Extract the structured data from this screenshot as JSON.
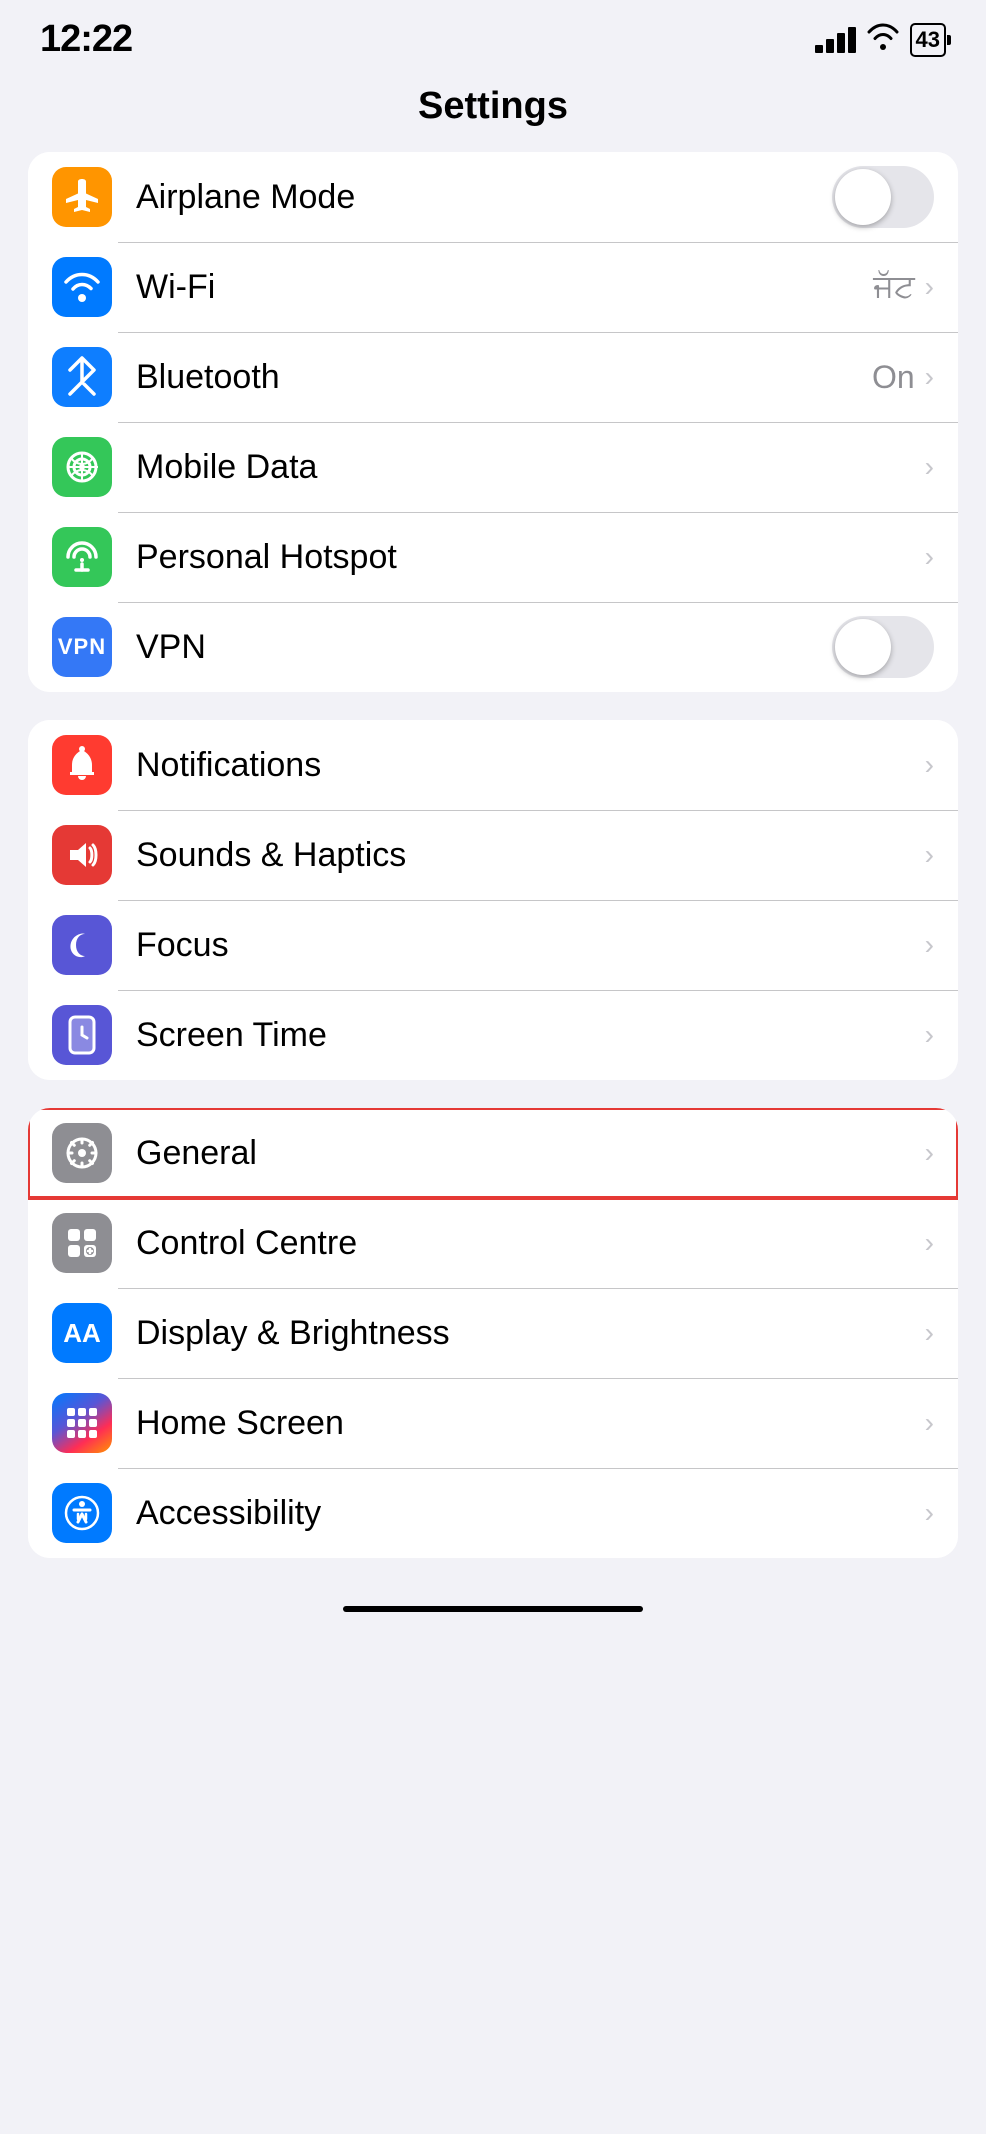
{
  "statusBar": {
    "time": "12:22",
    "battery": "43"
  },
  "pageTitle": "Settings",
  "groups": [
    {
      "id": "connectivity",
      "rows": [
        {
          "id": "airplane-mode",
          "label": "Airplane Mode",
          "icon": "airplane",
          "iconBg": "bg-orange",
          "control": "toggle",
          "toggleOn": false
        },
        {
          "id": "wifi",
          "label": "Wi-Fi",
          "icon": "wifi",
          "iconBg": "bg-blue",
          "control": "chevron",
          "value": "ਜੱਟ"
        },
        {
          "id": "bluetooth",
          "label": "Bluetooth",
          "icon": "bluetooth",
          "iconBg": "bg-blue-dark",
          "control": "chevron",
          "value": "On"
        },
        {
          "id": "mobile-data",
          "label": "Mobile Data",
          "icon": "signal",
          "iconBg": "bg-green",
          "control": "chevron",
          "value": ""
        },
        {
          "id": "personal-hotspot",
          "label": "Personal Hotspot",
          "icon": "hotspot",
          "iconBg": "bg-green",
          "control": "chevron",
          "value": ""
        },
        {
          "id": "vpn",
          "label": "VPN",
          "icon": "vpn",
          "iconBg": "bg-blue-vpn",
          "control": "toggle",
          "toggleOn": false
        }
      ]
    },
    {
      "id": "notifications-group",
      "rows": [
        {
          "id": "notifications",
          "label": "Notifications",
          "icon": "bell",
          "iconBg": "bg-red",
          "control": "chevron",
          "value": ""
        },
        {
          "id": "sounds-haptics",
          "label": "Sounds & Haptics",
          "icon": "speaker",
          "iconBg": "bg-red-sound",
          "control": "chevron",
          "value": ""
        },
        {
          "id": "focus",
          "label": "Focus",
          "icon": "moon",
          "iconBg": "bg-purple",
          "control": "chevron",
          "value": ""
        },
        {
          "id": "screen-time",
          "label": "Screen Time",
          "icon": "hourglass",
          "iconBg": "bg-purple-screen",
          "control": "chevron",
          "value": ""
        }
      ]
    },
    {
      "id": "general-group",
      "rows": [
        {
          "id": "general",
          "label": "General",
          "icon": "gear",
          "iconBg": "bg-gray",
          "control": "chevron",
          "value": "",
          "highlighted": true
        },
        {
          "id": "control-centre",
          "label": "Control Centre",
          "icon": "toggles",
          "iconBg": "bg-gray-cc",
          "control": "chevron",
          "value": ""
        },
        {
          "id": "display-brightness",
          "label": "Display & Brightness",
          "icon": "AA",
          "iconBg": "bg-blue-aa",
          "control": "chevron",
          "value": ""
        },
        {
          "id": "home-screen",
          "label": "Home Screen",
          "icon": "grid",
          "iconBg": "bg-multicolor",
          "control": "chevron",
          "value": ""
        },
        {
          "id": "accessibility",
          "label": "Accessibility",
          "icon": "person-circle",
          "iconBg": "bg-blue-access",
          "control": "chevron",
          "value": ""
        }
      ]
    }
  ],
  "icons": {
    "airplane": "✈",
    "wifi": "📶",
    "bluetooth": "✱",
    "signal": "((•))",
    "hotspot": "🔗",
    "vpn": "VPN",
    "bell": "🔔",
    "speaker": "🔊",
    "moon": "🌙",
    "hourglass": "⌛",
    "gear": "⚙",
    "toggles": "⊞",
    "AA": "AA",
    "grid": "⋮⋮⋮",
    "person-circle": "♿"
  }
}
